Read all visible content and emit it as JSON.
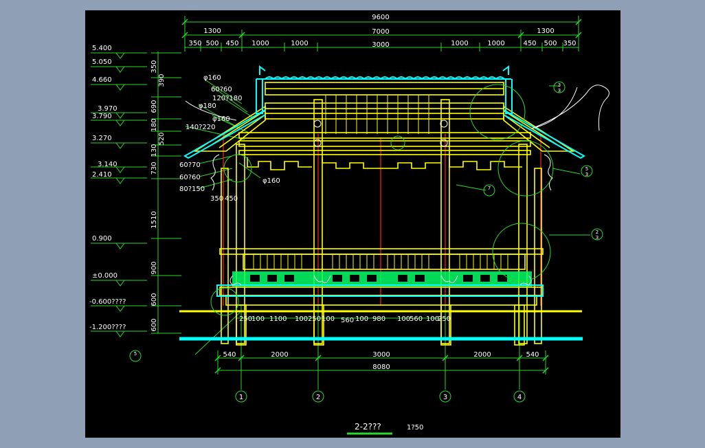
{
  "colors": {
    "background_outer": "#8f9fb5",
    "canvas": "#000000",
    "dim": "#2bd92b",
    "structure": "#ffff00",
    "accent": "#00ffff",
    "axis": "#ff2020",
    "text": "#ffffff",
    "detail": "#d8d8d8"
  },
  "drawing": {
    "title": "2-2???",
    "scale": "1?50"
  },
  "dims": {
    "overall": "9600",
    "top_row": [
      "1300",
      "7000",
      "1300"
    ],
    "second_row": [
      "350",
      "500",
      "450",
      "1000",
      "1000",
      "3000",
      "1000",
      "1000",
      "450",
      "500",
      "350"
    ],
    "bottom_row": [
      "540",
      "2000",
      "3000",
      "2000",
      "540"
    ],
    "bottom_overall": "8080",
    "foundation_row": [
      "250",
      "100",
      "1100",
      "100",
      "250",
      "100",
      "560",
      "100",
      "980",
      "100",
      "560",
      "100",
      "250"
    ]
  },
  "elevations": [
    "5.400",
    "5.050",
    "4.660",
    "3.970",
    "3.790",
    "3.270",
    "3.140",
    "2.410",
    "0.900",
    "±0.000",
    "-0.600????",
    "-1.200????"
  ],
  "vertical_dims": [
    "350",
    "390",
    "690",
    "180",
    "520",
    "130",
    "730",
    "1510",
    "900",
    "600",
    "600"
  ],
  "member_labels": [
    "φ160",
    "60?60",
    "120?180",
    "φ180",
    "φ160",
    "140?220",
    "60?70",
    "60?60",
    "80?150",
    "φ160"
  ],
  "small_dims": [
    "350",
    "450"
  ],
  "axes": [
    "1",
    "2",
    "3",
    "4"
  ],
  "detail_callouts": [
    {
      "num": "3",
      "sheet": "3"
    },
    {
      "num": "5",
      "sheet": "3"
    },
    {
      "num": "7",
      "sheet": ""
    },
    {
      "num": "2",
      "sheet": "3"
    },
    {
      "num": "5",
      "sheet": ""
    }
  ]
}
